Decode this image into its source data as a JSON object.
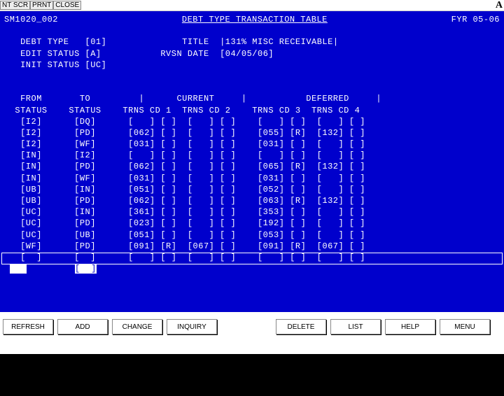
{
  "topbar": {
    "btn1": "NT SCR",
    "btn2": "PRNT",
    "btn3": "CLOSE",
    "corner": "A"
  },
  "header": {
    "screen_id": "SM1020_002",
    "title": "DEBT TYPE TRANSACTION TABLE",
    "fyr": "FYR 05-06"
  },
  "fields": {
    "debt_type_label": "DEBT TYPE",
    "debt_type": "[01]",
    "title_label": "TITLE",
    "title_val": "|131% MISC RECEIVABLE|",
    "edit_status_label": "EDIT STATUS",
    "edit_status": "[A]",
    "rvsn_date_label": "RVSN DATE",
    "rvsn_date": "[04/05/06]",
    "init_status_label": "INIT STATUS",
    "init_status": "[UC]"
  },
  "columns": {
    "l1": "FROM       TO         |      CURRENT     |           DEFERRED     |",
    "l2": "STATUS    STATUS    TRNS CD 1  TRNS CD 2    TRNS CD 3  TRNS CD 4"
  },
  "rows": [
    "[I2]      [DQ]      [   ] [ ]  [   ] [ ]    [   ] [ ]  [   ] [ ]",
    "[I2]      [PD]      [062] [ ]  [   ] [ ]    [055] [R]  [132] [ ]",
    "[I2]      [WF]      [031] [ ]  [   ] [ ]    [031] [ ]  [   ] [ ]",
    "[IN]      [I2]      [   ] [ ]  [   ] [ ]    [   ] [ ]  [   ] [ ]",
    "[IN]      [PD]      [062] [ ]  [   ] [ ]    [065] [R]  [132] [ ]",
    "[IN]      [WF]      [031] [ ]  [   ] [ ]    [031] [ ]  [   ] [ ]",
    "[UB]      [IN]      [051] [ ]  [   ] [ ]    [052] [ ]  [   ] [ ]",
    "[UB]      [PD]      [062] [ ]  [   ] [ ]    [063] [R]  [132] [ ]",
    "[UC]      [IN]      [361] [ ]  [   ] [ ]    [353] [ ]  [   ] [ ]",
    "[UC]      [PD]      [023] [ ]  [   ] [ ]    [192] [ ]  [   ] [ ]",
    "[UC]      [UB]      [051] [ ]  [   ] [ ]    [053] [ ]  [   ] [ ]",
    "[WF]      [PD]      [091] [R]  [067] [ ]    [091] [R]  [067] [ ]",
    "[  ]      [  ]      [   ] [ ]  [   ] [ ]    [   ] [ ]  [   ] [ ]"
  ],
  "footer_line": "[  ]",
  "buttons": {
    "refresh": "REFRESH",
    "add": "ADD",
    "change": "CHANGE",
    "inquiry": "INQUIRY",
    "delete": "DELETE",
    "list": "LIST",
    "help": "HELP",
    "menu": "MENU"
  }
}
